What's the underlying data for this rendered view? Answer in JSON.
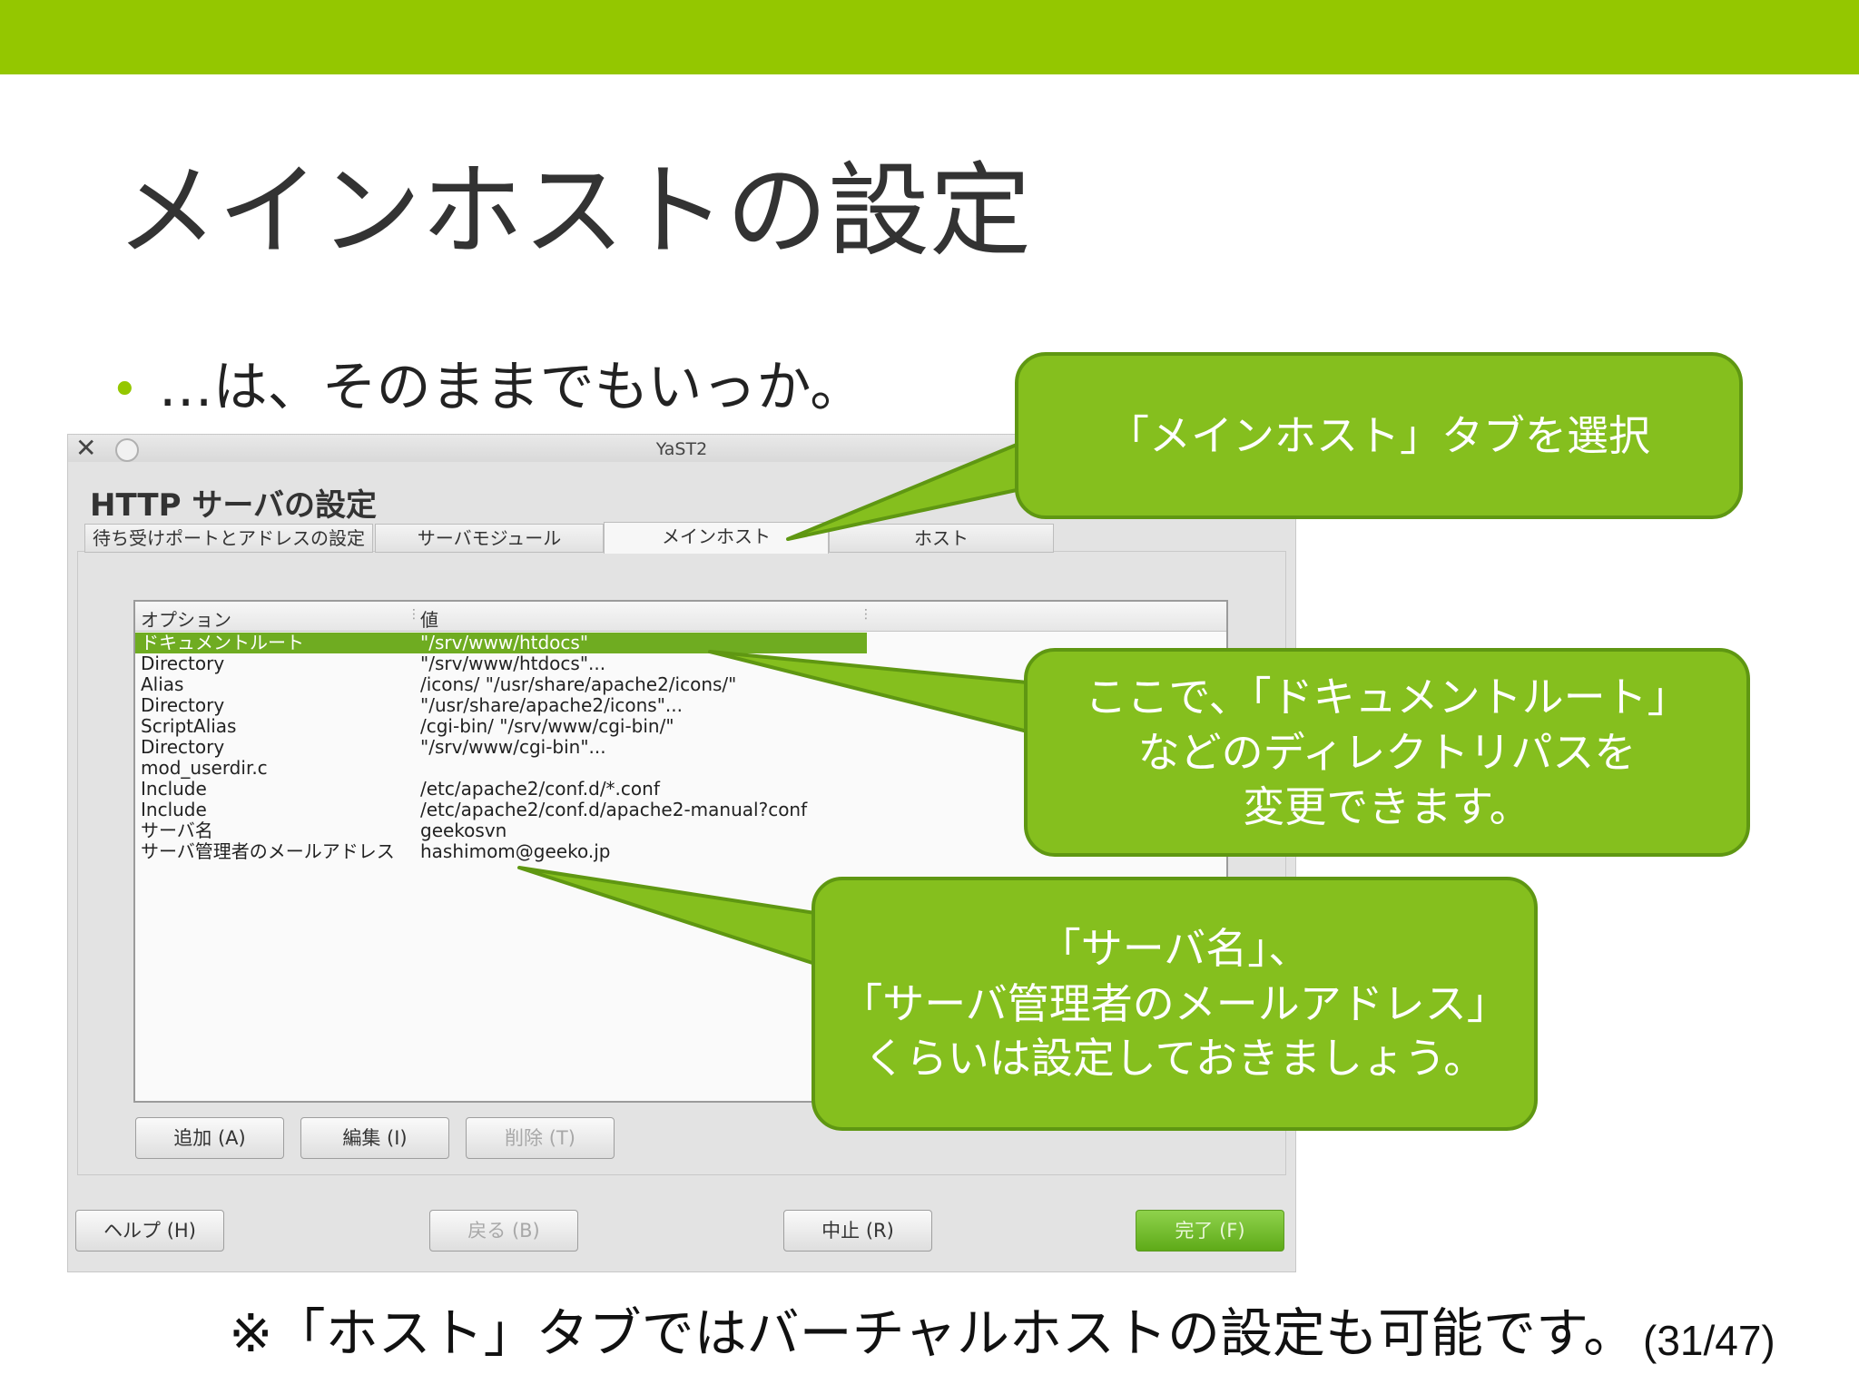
{
  "colors": {
    "brand_green": "#94c700",
    "callout_fill": "#85bf1e",
    "callout_border": "#5f9712",
    "selection": "#6fac21"
  },
  "slide": {
    "title": "メインホストの設定",
    "bullet": "…は、そのままでもいっか。",
    "footnote": "※「ホスト」タブではバーチャルホストの設定も可能です。",
    "page": "(31/47)"
  },
  "window": {
    "title": "YaST2",
    "close_icon": "x-icon",
    "heading": "HTTP サーバの設定",
    "tabs": [
      {
        "label": "待ち受けポートとアドレスの設定",
        "active": false
      },
      {
        "label": "サーバモジュール",
        "active": false
      },
      {
        "label": "メインホスト",
        "active": true
      },
      {
        "label": "ホスト",
        "active": false
      }
    ],
    "table": {
      "headers": [
        "オプション",
        "値"
      ],
      "rows": [
        {
          "option": "ドキュメントルート",
          "value": "\"/srv/www/htdocs\""
        },
        {
          "option": "Directory",
          "value": "\"/srv/www/htdocs\"..."
        },
        {
          "option": "Alias",
          "value": "/icons/ \"/usr/share/apache2/icons/\""
        },
        {
          "option": "Directory",
          "value": "\"/usr/share/apache2/icons\"..."
        },
        {
          "option": "ScriptAlias",
          "value": "/cgi-bin/ \"/srv/www/cgi-bin/\""
        },
        {
          "option": "Directory",
          "value": "\"/srv/www/cgi-bin\"..."
        },
        {
          "option": "mod_userdir.c",
          "value": ""
        },
        {
          "option": "Include",
          "value": "/etc/apache2/conf.d/*.conf"
        },
        {
          "option": "Include",
          "value": "/etc/apache2/conf.d/apache2-manual?conf"
        },
        {
          "option": "サーバ名",
          "value": "geekosvn"
        },
        {
          "option": "サーバ管理者のメールアドレス",
          "value": "hashimom@geeko.jp"
        }
      ]
    },
    "buttons": {
      "add": "追加 (A)",
      "edit": "編集 (I)",
      "delete": "削除 (T)",
      "help": "ヘルプ (H)",
      "back": "戻る (B)",
      "abort": "中止 (R)",
      "finish": "完了 (F)"
    }
  },
  "callouts": {
    "tab": [
      "「メインホスト」タブを選択"
    ],
    "docroot": [
      "ここで、「ドキュメントルート」",
      "などのディレクトリパスを",
      "変更できます。"
    ],
    "server": [
      "「サーバ名」、",
      "「サーバ管理者のメールアドレス」",
      "くらいは設定しておきましょう。"
    ]
  }
}
